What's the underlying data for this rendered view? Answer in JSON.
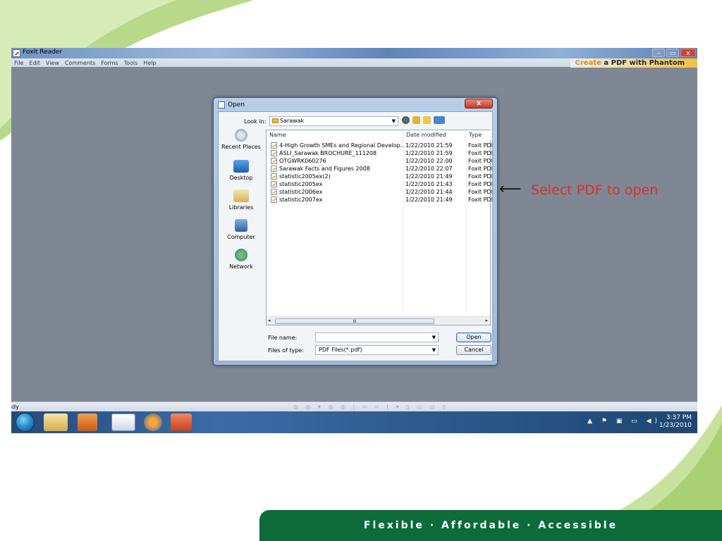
{
  "slide": {
    "footer_text": "Flexible  ·  Affordable  ·  Accessible",
    "annotation_arrow": "⟵",
    "annotation_text": "Select PDF to open",
    "annotation_color": "#d8302a",
    "brand_green": "#0d6b3a"
  },
  "app": {
    "title": "Foxit Reader",
    "menu": [
      "File",
      "Edit",
      "View",
      "Comments",
      "Forms",
      "Tools",
      "Help"
    ],
    "promo_highlight": "Create",
    "promo_rest": " a PDF with Phantom",
    "window_buttons": {
      "minimize": "–",
      "maximize": "▭",
      "close": "x"
    },
    "status": "Ready",
    "status_tools": "◎ ◎ ▾ ◎ ◎ | ⇦ ⇨ | ▾ ▯ ▭ ▭ ▯"
  },
  "dialog": {
    "title": "Open",
    "close_label": "x",
    "look_in_label": "Look in:",
    "look_in_value": "Sarawak",
    "places": [
      "Recent Places",
      "Desktop",
      "Libraries",
      "Computer",
      "Network"
    ],
    "columns": {
      "name": "Name",
      "date": "Date modified",
      "type": "Type"
    },
    "files": [
      {
        "name": "4-High Growth SMEs and Regional Develop...",
        "date": "1/22/2010 21:59",
        "type": "Foxit PDF"
      },
      {
        "name": "ASLI_Sarawak BROCHURE_111208",
        "date": "1/22/2010 21:59",
        "type": "Foxit PDF"
      },
      {
        "name": "OTGWRK060276",
        "date": "1/22/2010 22:00",
        "type": "Foxit PDF"
      },
      {
        "name": "Sarawak Facts and Figures 2008",
        "date": "1/22/2010 22:07",
        "type": "Foxit PDF"
      },
      {
        "name": "statistic2005ex(2)",
        "date": "1/22/2010 21:49",
        "type": "Foxit PDF"
      },
      {
        "name": "statistic2005ex",
        "date": "1/22/2010 21:43",
        "type": "Foxit PDF"
      },
      {
        "name": "statistic2006ex",
        "date": "1/22/2010 21:44",
        "type": "Foxit PDF"
      },
      {
        "name": "statistic2007ex",
        "date": "1/22/2010 21:49",
        "type": "Foxit PDF"
      }
    ],
    "scroll_grip": "III",
    "file_name_label": "File name:",
    "file_name_value": "",
    "file_type_label": "Files of type:",
    "file_type_value": "PDF Files(*.pdf)",
    "open_button": "Open",
    "cancel_button": "Cancel"
  },
  "taskbar": {
    "time": "3:37 PM",
    "date": "1/23/2010",
    "tray": "▲ ⚑ ▣ ▭ ◀)"
  }
}
